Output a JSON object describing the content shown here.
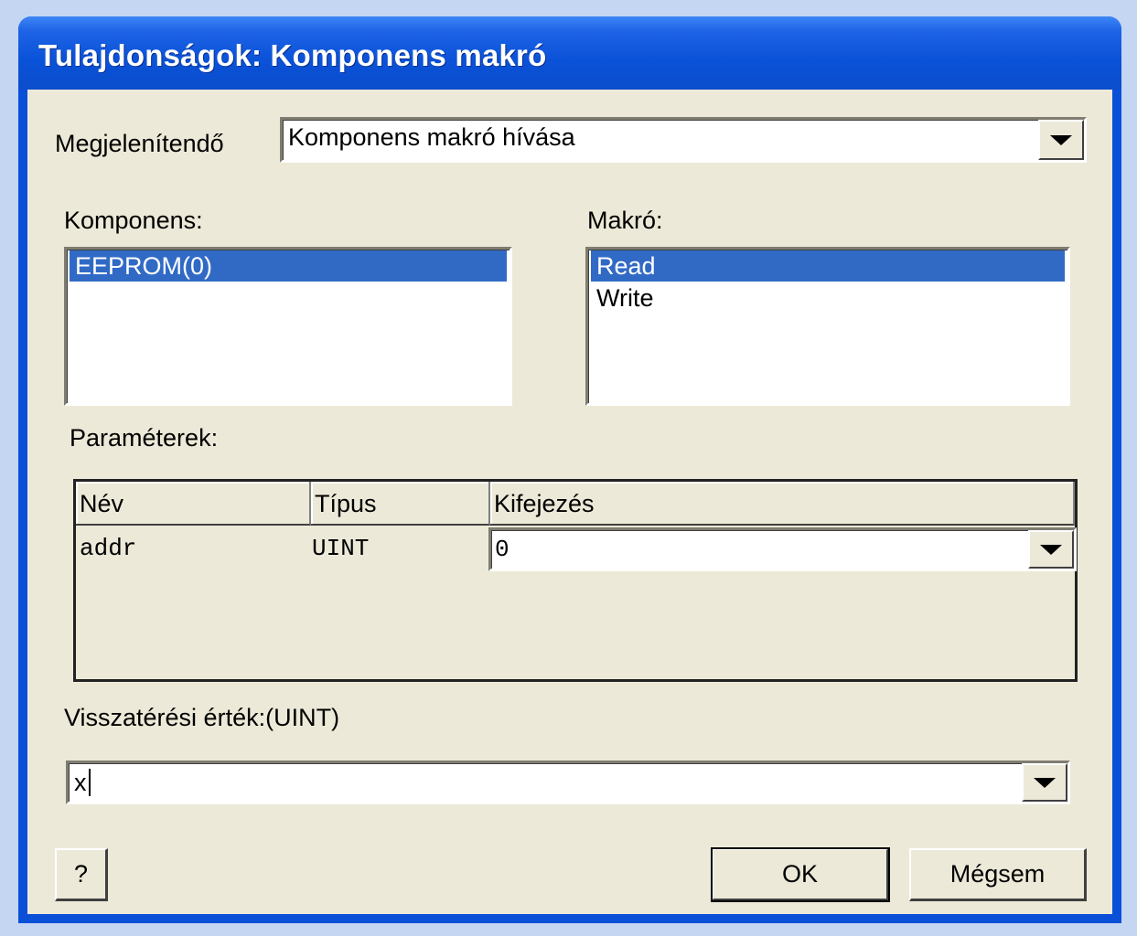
{
  "window": {
    "title": "Tulajdonságok: Komponens makró"
  },
  "display": {
    "label": "Megjelenítendő",
    "value": "Komponens makró hívása"
  },
  "component": {
    "label": "Komponens:",
    "items": [
      "EEPROM(0)"
    ],
    "selected": "EEPROM(0)"
  },
  "macro": {
    "label": "Makró:",
    "items": [
      "Read",
      "Write"
    ],
    "selected": "Read"
  },
  "parameters": {
    "label": "Paraméterek:",
    "columns": [
      "Név",
      "Típus",
      "Kifejezés"
    ],
    "rows": [
      {
        "name": "addr",
        "type": "UINT",
        "expression": "0"
      }
    ]
  },
  "return_value": {
    "label": "Visszatérési érték:(UINT)",
    "value": "x"
  },
  "buttons": {
    "help": "?",
    "ok": "OK",
    "cancel": "Mégsem"
  },
  "colors": {
    "titlebar": "#0a52d8",
    "selection": "#316ac5",
    "dialog_bg": "#ece9d8"
  }
}
